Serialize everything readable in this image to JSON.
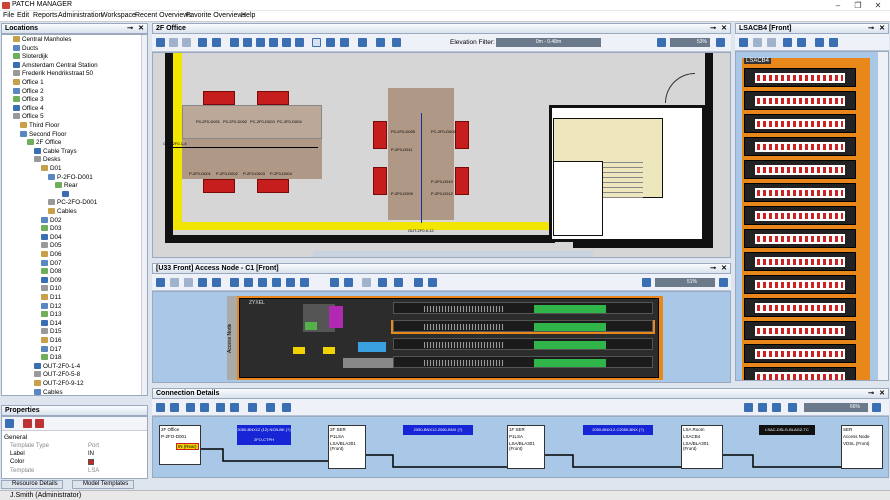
{
  "app": {
    "title": "PATCH MANAGER"
  },
  "menu": [
    "File",
    "Edit",
    "Reports",
    "Administration",
    "Workspace",
    "Recent Overviews",
    "Favorite Overviews",
    "Help"
  ],
  "locations": {
    "title": "Locations",
    "items": [
      {
        "label": "Central Manholes",
        "indent": 3
      },
      {
        "label": "Ducts",
        "indent": 3
      },
      {
        "label": "Sloterdijk",
        "indent": 3
      },
      {
        "label": "Amsterdam Central Station",
        "indent": 3
      },
      {
        "label": "Frederik Hendrikstraat 50",
        "indent": 3
      },
      {
        "label": "Office 1",
        "indent": 3
      },
      {
        "label": "Office 2",
        "indent": 3
      },
      {
        "label": "Office 3",
        "indent": 3
      },
      {
        "label": "Office 4",
        "indent": 3
      },
      {
        "label": "Office 5",
        "indent": 3
      },
      {
        "label": "Third Floor",
        "indent": 4
      },
      {
        "label": "Second Floor",
        "indent": 4
      },
      {
        "label": "2F Office",
        "indent": 5
      },
      {
        "label": "Cable Trays",
        "indent": 6
      },
      {
        "label": "Desks",
        "indent": 6
      },
      {
        "label": "D01",
        "indent": 7
      },
      {
        "label": "P-2FO-D001",
        "indent": 8
      },
      {
        "label": "Rear",
        "indent": 9
      },
      {
        "label": "",
        "indent": 10
      },
      {
        "label": "PC-2FO-D001",
        "indent": 8
      },
      {
        "label": "Cables",
        "indent": 8
      },
      {
        "label": "D02",
        "indent": 7
      },
      {
        "label": "D03",
        "indent": 7
      },
      {
        "label": "D04",
        "indent": 7
      },
      {
        "label": "D05",
        "indent": 7
      },
      {
        "label": "D06",
        "indent": 7
      },
      {
        "label": "D07",
        "indent": 7
      },
      {
        "label": "D08",
        "indent": 7
      },
      {
        "label": "D09",
        "indent": 7
      },
      {
        "label": "D10",
        "indent": 7
      },
      {
        "label": "D11",
        "indent": 7
      },
      {
        "label": "D12",
        "indent": 7
      },
      {
        "label": "D13",
        "indent": 7
      },
      {
        "label": "D14",
        "indent": 7
      },
      {
        "label": "D15",
        "indent": 7
      },
      {
        "label": "D16",
        "indent": 7
      },
      {
        "label": "D17",
        "indent": 7
      },
      {
        "label": "D18",
        "indent": 7
      },
      {
        "label": "OUT-2F0-1-4",
        "indent": 6
      },
      {
        "label": "OUT-2F0-5-8",
        "indent": 6
      },
      {
        "label": "OUT-2F0-9-12",
        "indent": 6
      },
      {
        "label": "Cables",
        "indent": 6
      }
    ]
  },
  "properties": {
    "title": "Properties",
    "section": "General",
    "rows": [
      {
        "key": "Template Type",
        "value": "Port"
      },
      {
        "key": "Label",
        "value": "IN"
      },
      {
        "key": "Color",
        "value": ""
      },
      {
        "key": "Template",
        "value": "LSA"
      }
    ]
  },
  "floorplan": {
    "title": "2F Office",
    "elevation_label": "Elevation Filter:",
    "elevation_value": "0m - 0.48m",
    "zoom": "53%",
    "labels": [
      "P0-2F0-D001",
      "P0-2F0-D002",
      "PC-2F0-D003",
      "PC-2F0-D004",
      "P-2F0-D001",
      "P-2F0-D002",
      "P-2F0-D003",
      "P-2F0-D004",
      "P0-2F0-D005",
      "PC-2F0-D006",
      "P-2F0-D009",
      "P-2F0-D010",
      "P-2F0-D011",
      "P-2F0-D012",
      "OUT-2F0-1-4",
      "OUT-2F0-9-12"
    ]
  },
  "rack": {
    "title": "LSACB4 [Front]",
    "label": "LSACB4"
  },
  "accessnode": {
    "title": "[U33 Front] Access Node - C1 [Front]",
    "zoom": "51%",
    "brand": "ZYXEL",
    "side_label": "Access Node"
  },
  "connection": {
    "title": "Connection Details",
    "zoom": "66%",
    "nodes": [
      {
        "title": "2F Office",
        "sub": "P-2FO-D001",
        "port": "IN (Rear)"
      },
      {
        "title": "2F SER",
        "sub": "P1LSA",
        "port": "LSA/BLA301 (Front)"
      },
      {
        "title": "1F SER",
        "sub": "P1LSA",
        "port": "LSA/BLA301 (Front)"
      },
      {
        "title": "LSA Room",
        "sub": "LSACB4",
        "port": "LSA/BLA301 (Front)"
      },
      {
        "title": "SER",
        "sub": "Access Node",
        "port": "VDSL (Front)"
      }
    ],
    "bands": [
      "2050-BNX12 (12) NCB-BK (?)",
      "2050-BNX12-2050-BNX (?)",
      "2050-BNX12-C2050-BNX (?)",
      "LSAC-DSLG-BLAGZ-TC"
    ],
    "mid_label": "2FO-CTPH"
  },
  "bottom_tabs": [
    "Resource Details",
    "Model Templates"
  ],
  "status": {
    "user": "J.Smith (Administrator)"
  },
  "colors": {
    "accent": "#3a6fb3",
    "wall": "#111",
    "tray": "#f2e600",
    "chair": "#c61d1d",
    "desk": "#b09886",
    "highlight": "#e8881a",
    "band": "#1626d6"
  }
}
